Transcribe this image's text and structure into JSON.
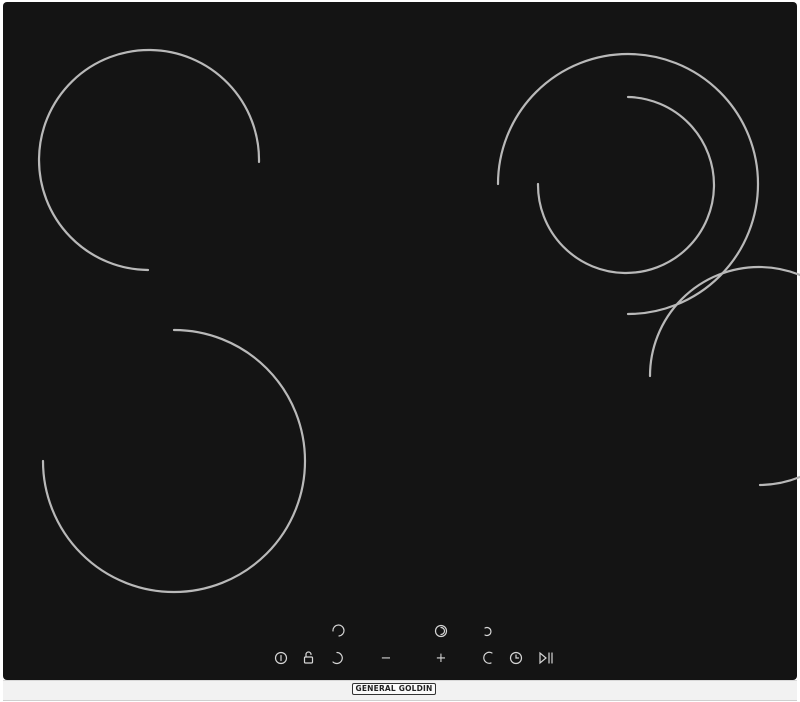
{
  "brand": {
    "label": "GENERAL GOLDIN"
  },
  "controls": {
    "minus_label": "−",
    "plus_label": "+"
  },
  "colors": {
    "glass": "#141414",
    "zone_line": "#b9b9b9",
    "control_symbol": "#d6d6d6",
    "frame": "#f2f2f2"
  },
  "icons": [
    "power-icon",
    "lock-icon",
    "zone-select-icon",
    "dual-zone-icon",
    "timer-icon",
    "pause-play-icon"
  ]
}
